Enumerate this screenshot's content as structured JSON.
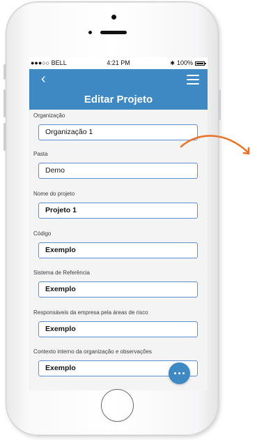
{
  "status_bar": {
    "carrier": "●●●○○ BELL",
    "time": "4:21 PM",
    "battery": "100%"
  },
  "nav": {
    "back_glyph": "‹",
    "title": "Editar Projeto"
  },
  "fields": [
    {
      "label": "Organização",
      "value": "Organização 1"
    },
    {
      "label": "Pasta",
      "value": "Demo"
    },
    {
      "label": "Nome do projeto",
      "value": "Projeto 1"
    },
    {
      "label": "Código",
      "value": "Exemplo"
    },
    {
      "label": "Sistema de Referência",
      "value": "Exemplo"
    },
    {
      "label": "Responsáveis da empresa pela áreas de risco",
      "value": "Exemplo"
    },
    {
      "label": "Contexto interno da organização e observações",
      "value": "Exemplo"
    }
  ],
  "icons": {
    "back": "chevron-left-icon",
    "menu": "hamburger-menu-icon",
    "fab": "more-dots-icon",
    "annotation": "curved-arrow-icon"
  },
  "colors": {
    "accent": "#3e89c4",
    "annotation_arrow": "#e8742a"
  }
}
